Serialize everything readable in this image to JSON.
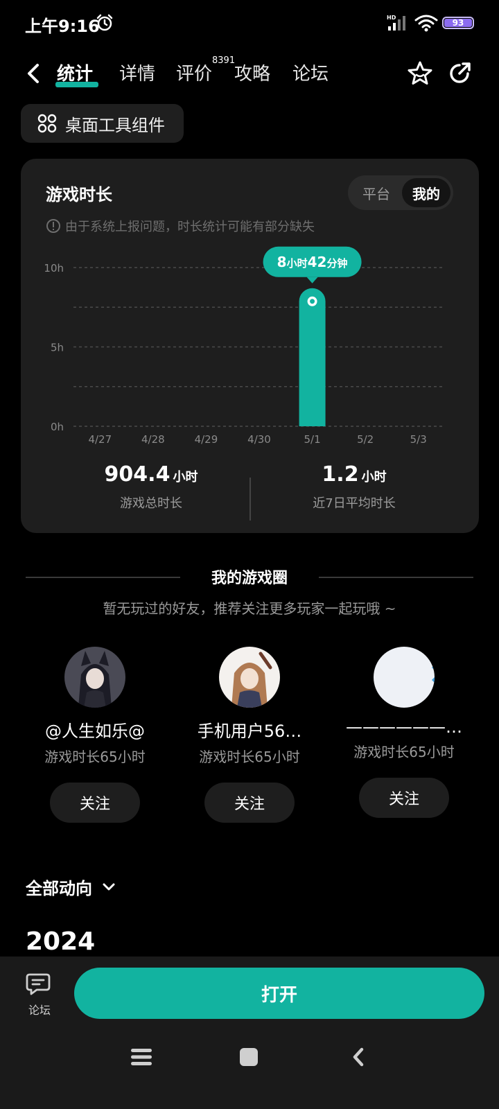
{
  "status_bar": {
    "time": "上午9:16",
    "battery": "93"
  },
  "nav": {
    "tabs": [
      "统计",
      "详情",
      "评价",
      "攻略",
      "论坛"
    ],
    "review_count": "8391"
  },
  "widget_button": "桌面工具组件",
  "playtime_card": {
    "title": "游戏时长",
    "toggle": {
      "options": [
        "平台",
        "我的"
      ],
      "selected": "我的"
    },
    "notice": "由于系统上报问题，时长统计可能有部分缺失",
    "tooltip": {
      "num1": "8",
      "unit1": "小时",
      "num2": "42",
      "unit2": "分钟"
    },
    "total": {
      "value": "904.4",
      "unit": "小时",
      "label": "游戏总时长"
    },
    "average": {
      "value": "1.2",
      "unit": "小时",
      "label": "近7日平均时长"
    }
  },
  "chart_data": {
    "type": "bar",
    "categories": [
      "4/27",
      "4/28",
      "4/29",
      "4/30",
      "5/1",
      "5/2",
      "5/3"
    ],
    "values": [
      0,
      0,
      0,
      0,
      8.7,
      0,
      0
    ],
    "y_ticks": [
      "10h",
      "5h",
      "0h"
    ],
    "ylim": [
      0,
      10
    ],
    "grid": true,
    "bar_color": "#12b3a0"
  },
  "game_circle": {
    "title": "我的游戏圈",
    "hint": "暂无玩过的好友，推荐关注更多玩家一起玩哦 ~",
    "friends": [
      {
        "name": "@人生如乐@",
        "playtime": "游戏时长65小时",
        "follow": "关注"
      },
      {
        "name": "手机用户56…",
        "playtime": "游戏时长65小时",
        "follow": "关注"
      },
      {
        "name": "——————…",
        "playtime": "游戏时长65小时",
        "follow": "关注"
      }
    ]
  },
  "activity": {
    "filter": "全部动向",
    "year": "2024"
  },
  "bottom": {
    "forum_label": "论坛",
    "open_label": "打开"
  },
  "colors": {
    "accent": "#12b3a0",
    "card": "#1e1e1e",
    "background": "#000000"
  }
}
